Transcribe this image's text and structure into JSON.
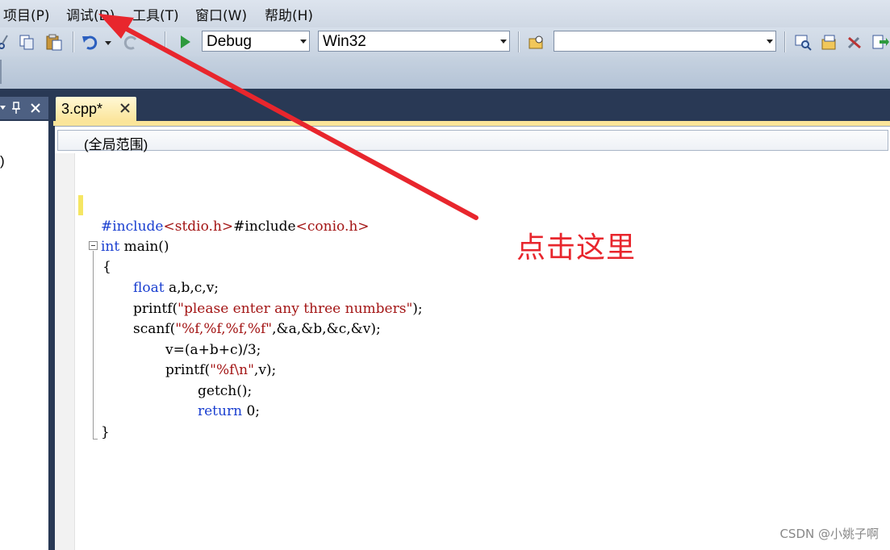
{
  "menu": {
    "items": [
      {
        "label": "项目(P)"
      },
      {
        "label": "调试(D)"
      },
      {
        "label": "工具(T)"
      },
      {
        "label": "窗口(W)"
      },
      {
        "label": "帮助(H)"
      }
    ]
  },
  "toolbar": {
    "config_combo": "Debug",
    "platform_combo": "Win32",
    "find_combo": "",
    "icons": [
      "cut-icon",
      "copy-icon",
      "paste-icon",
      "undo-icon",
      "redo-icon",
      "start-debug-icon",
      "find-in-files-icon",
      "find-icon",
      "solution-explorer-icon",
      "properties-icon",
      "toolbox-icon",
      "output-icon"
    ]
  },
  "left_panel": {
    "pin_glyph": "⊥",
    "close_glyph": "✕",
    "body_fragment": ")"
  },
  "editor": {
    "tab_label": "3.cpp*",
    "tab_close_glyph": "✕",
    "scope": "(全局范围)",
    "code": {
      "line1_a": "#include",
      "line1_b": "<stdio.h>",
      "line1_c": "#include",
      "line1_d": "<conio.h>",
      "line2_kw": "int",
      "line2_rest": " main()",
      "line3": "{",
      "line4_kw": "float",
      "line4_rest": " a,b,c,v;",
      "line5_a": "printf(",
      "line5_str": "\"please enter any three numbers\"",
      "line5_b": ");",
      "line6_a": "scanf(",
      "line6_str": "\"%f,%f,%f,%f\"",
      "line6_b": ",&a,&b,&c,&v);",
      "line7": "v=(a+b+c)/3;",
      "line8_a": "printf(",
      "line8_str": "\"%f\\n\"",
      "line8_b": ",v);",
      "line9": "getch();",
      "line10_kw": "return",
      "line10_rest": " 0;",
      "line11": "}"
    }
  },
  "annotation": {
    "text": "点击这里",
    "color": "#e8262d"
  },
  "watermark": "CSDN @小姚子啊"
}
